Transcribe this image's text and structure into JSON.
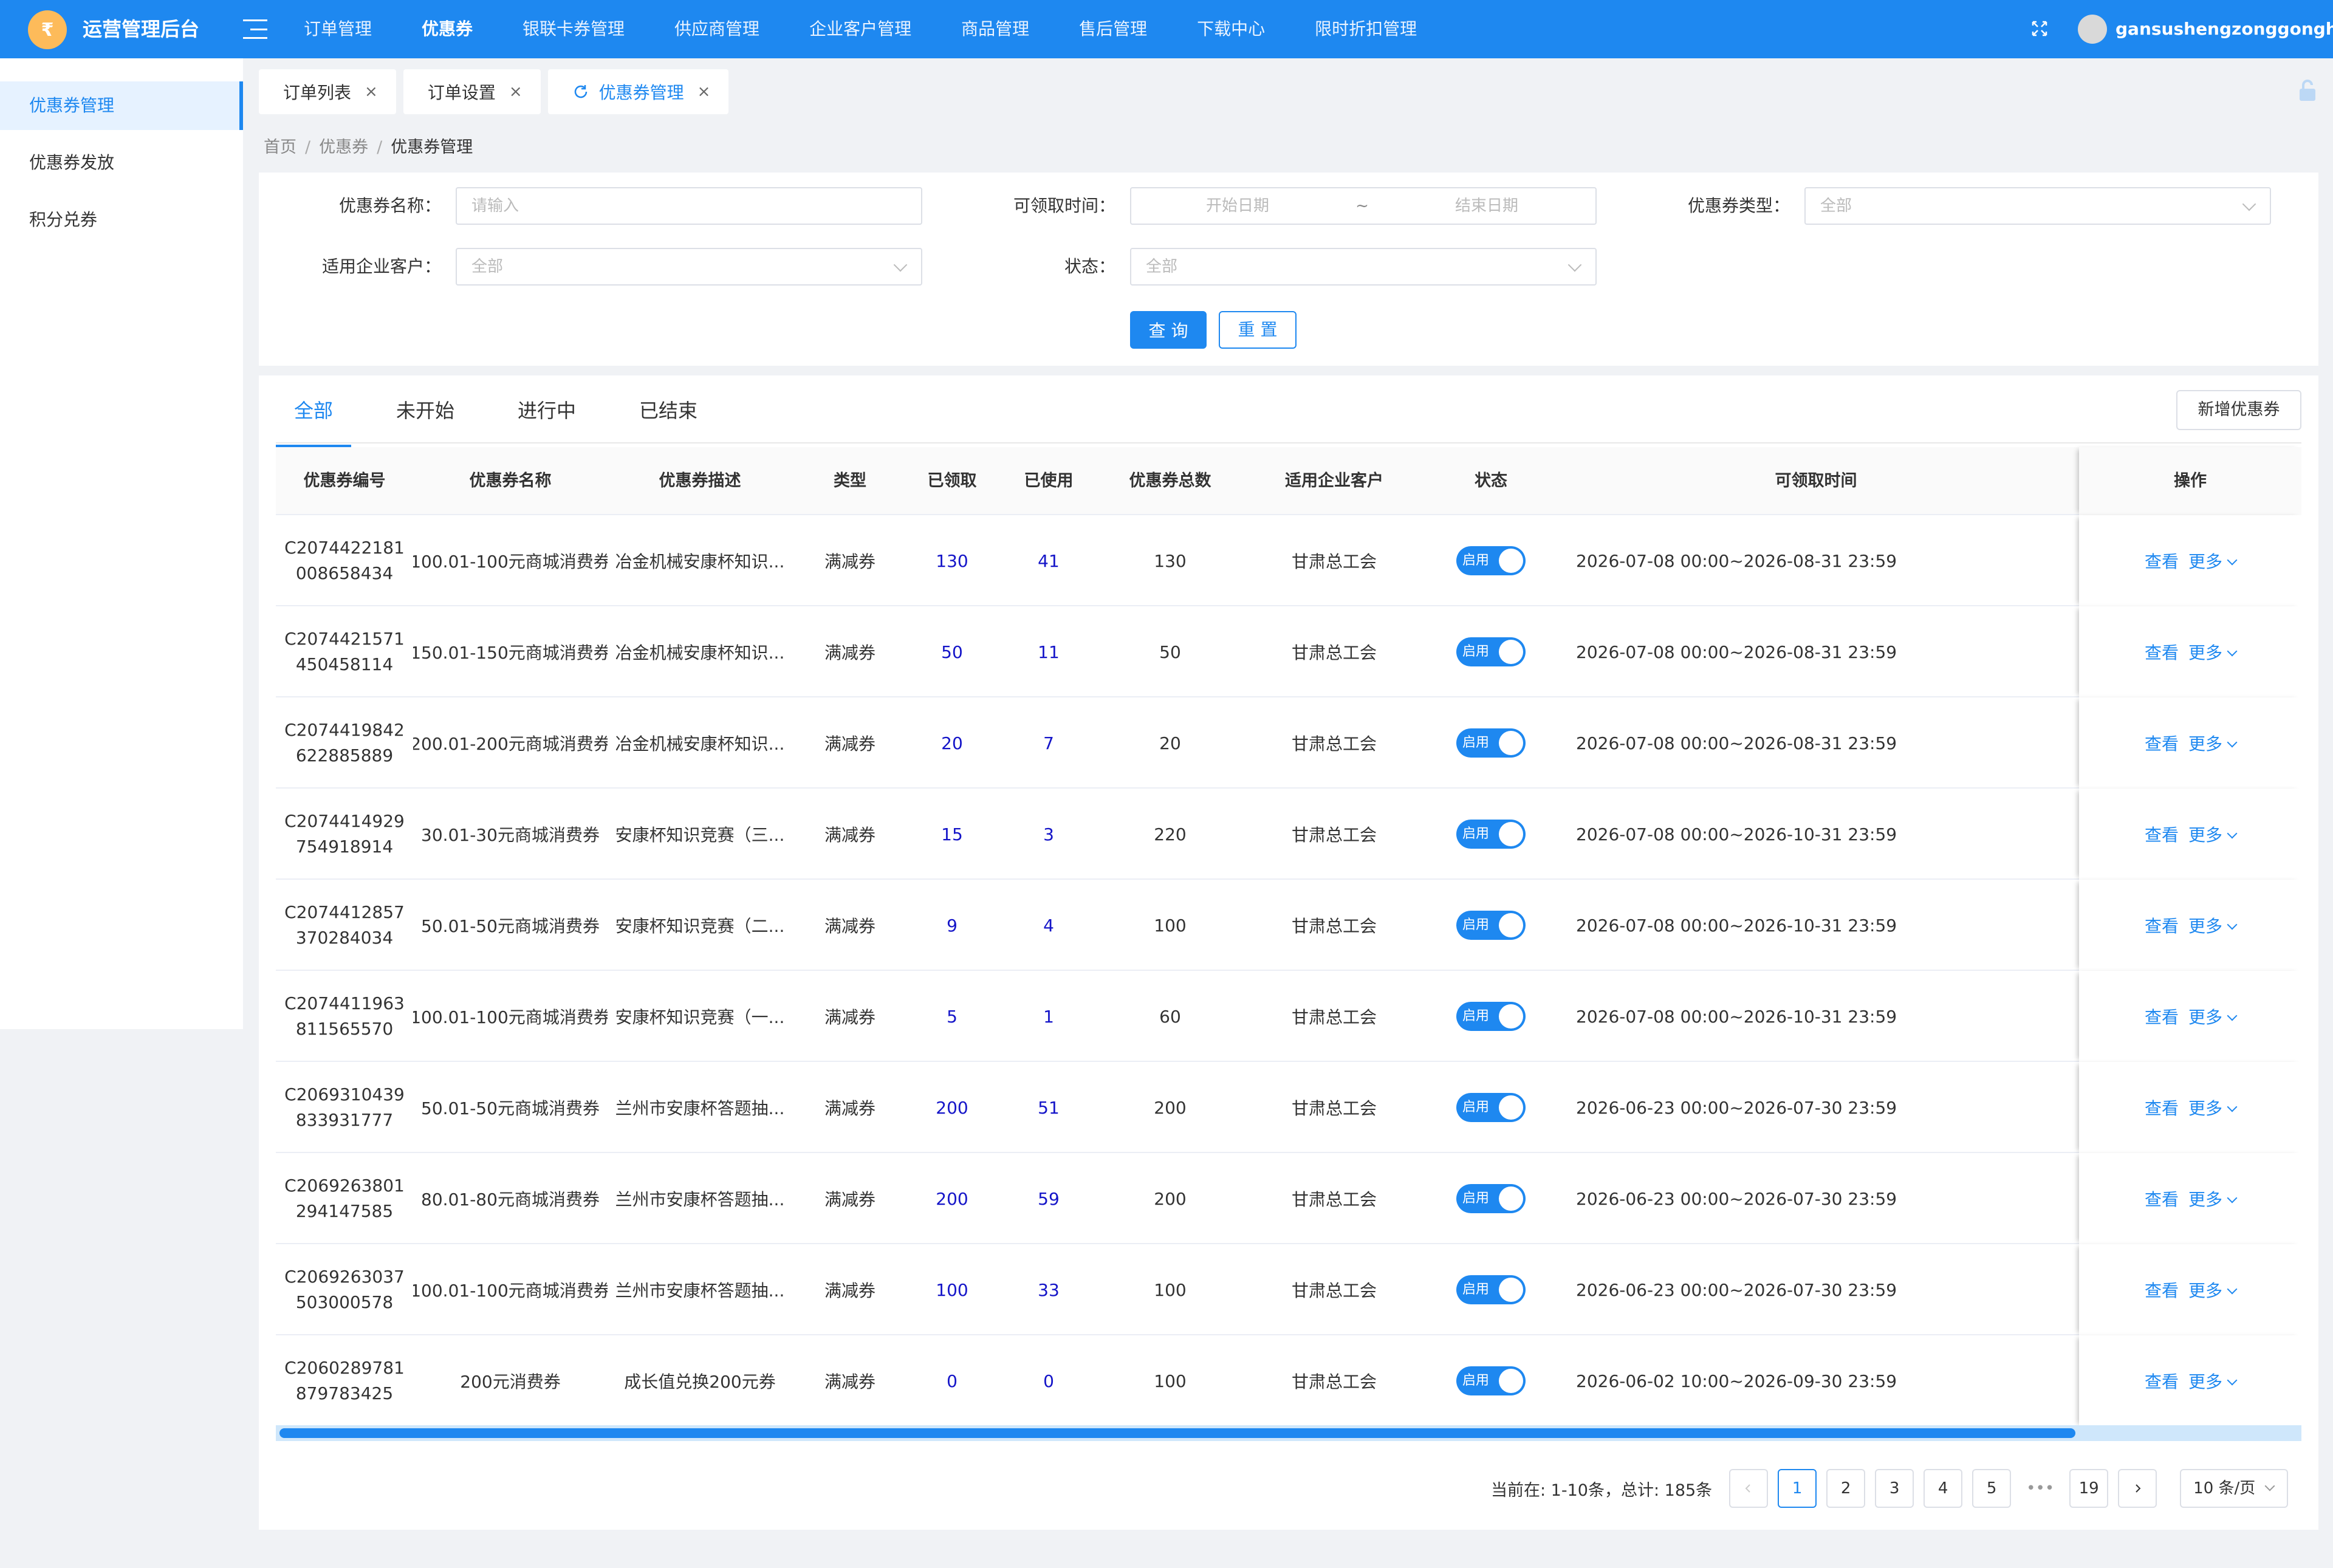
{
  "app": {
    "title": "运营管理后台",
    "logo_char": "₹",
    "username": "gansushengzonggonghui"
  },
  "topnav": [
    {
      "label": "订单管理"
    },
    {
      "label": "优惠券",
      "active": true
    },
    {
      "label": "银联卡券管理"
    },
    {
      "label": "供应商管理"
    },
    {
      "label": "企业客户管理"
    },
    {
      "label": "商品管理"
    },
    {
      "label": "售后管理"
    },
    {
      "label": "下载中心"
    },
    {
      "label": "限时折扣管理"
    }
  ],
  "sidebar": [
    {
      "label": "优惠券管理",
      "active": true
    },
    {
      "label": "优惠券发放"
    },
    {
      "label": "积分兑券"
    }
  ],
  "page_tabs": [
    {
      "label": "订单列表"
    },
    {
      "label": "订单设置"
    },
    {
      "label": "优惠券管理",
      "active": true
    }
  ],
  "breadcrumb": {
    "home": "首页",
    "level1": "优惠券",
    "current": "优惠券管理",
    "sep": "/"
  },
  "filters": {
    "name_label": "优惠券名称：",
    "name_placeholder": "请输入",
    "time_label": "可领取时间：",
    "time_start": "开始日期",
    "time_sep": "~",
    "time_end": "结束日期",
    "type_label": "优惠券类型：",
    "type_value": "全部",
    "customer_label": "适用企业客户：",
    "customer_value": "全部",
    "status_label": "状态：",
    "status_value": "全部",
    "search_button": "查 询",
    "reset_button": "重 置"
  },
  "status_tabs": [
    {
      "label": "全部",
      "active": true
    },
    {
      "label": "未开始"
    },
    {
      "label": "进行中"
    },
    {
      "label": "已结束"
    }
  ],
  "add_button": "新增优惠券",
  "columns": [
    "优惠券编号",
    "优惠券名称",
    "优惠券描述",
    "类型",
    "已领取",
    "已使用",
    "优惠券总数",
    "适用企业客户",
    "状态",
    "可领取时间",
    "操作"
  ],
  "rows": [
    {
      "code": "C2074422181008658434",
      "name": "100.01-100元商城消费券",
      "desc": "冶金机械安康杯知识...",
      "type": "满减券",
      "claimed": "130",
      "used": "41",
      "total": "130",
      "customer": "甘肃总工会",
      "status": "启用",
      "time": "2026-07-08 00:00~2026-08-31 23:59"
    },
    {
      "code": "C2074421571450458114",
      "name": "150.01-150元商城消费券",
      "desc": "冶金机械安康杯知识...",
      "type": "满减券",
      "claimed": "50",
      "used": "11",
      "total": "50",
      "customer": "甘肃总工会",
      "status": "启用",
      "time": "2026-07-08 00:00~2026-08-31 23:59"
    },
    {
      "code": "C2074419842622885889",
      "name": "200.01-200元商城消费券",
      "desc": "冶金机械安康杯知识...",
      "type": "满减券",
      "claimed": "20",
      "used": "7",
      "total": "20",
      "customer": "甘肃总工会",
      "status": "启用",
      "time": "2026-07-08 00:00~2026-08-31 23:59"
    },
    {
      "code": "C2074414929754918914",
      "name": "30.01-30元商城消费券",
      "desc": "安康杯知识竞赛（三...",
      "type": "满减券",
      "claimed": "15",
      "used": "3",
      "total": "220",
      "customer": "甘肃总工会",
      "status": "启用",
      "time": "2026-07-08 00:00~2026-10-31 23:59"
    },
    {
      "code": "C2074412857370284034",
      "name": "50.01-50元商城消费券",
      "desc": "安康杯知识竞赛（二...",
      "type": "满减券",
      "claimed": "9",
      "used": "4",
      "total": "100",
      "customer": "甘肃总工会",
      "status": "启用",
      "time": "2026-07-08 00:00~2026-10-31 23:59"
    },
    {
      "code": "C2074411963811565570",
      "name": "100.01-100元商城消费券",
      "desc": "安康杯知识竞赛（一...",
      "type": "满减券",
      "claimed": "5",
      "used": "1",
      "total": "60",
      "customer": "甘肃总工会",
      "status": "启用",
      "time": "2026-07-08 00:00~2026-10-31 23:59"
    },
    {
      "code": "C2069310439833931777",
      "name": "50.01-50元商城消费券",
      "desc": "兰州市安康杯答题抽...",
      "type": "满减券",
      "claimed": "200",
      "used": "51",
      "total": "200",
      "customer": "甘肃总工会",
      "status": "启用",
      "time": "2026-06-23 00:00~2026-07-30 23:59"
    },
    {
      "code": "C2069263801294147585",
      "name": "80.01-80元商城消费券",
      "desc": "兰州市安康杯答题抽...",
      "type": "满减券",
      "claimed": "200",
      "used": "59",
      "total": "200",
      "customer": "甘肃总工会",
      "status": "启用",
      "time": "2026-06-23 00:00~2026-07-30 23:59"
    },
    {
      "code": "C2069263037503000578",
      "name": "100.01-100元商城消费券",
      "desc": "兰州市安康杯答题抽...",
      "type": "满减券",
      "claimed": "100",
      "used": "33",
      "total": "100",
      "customer": "甘肃总工会",
      "status": "启用",
      "time": "2026-06-23 00:00~2026-07-30 23:59"
    },
    {
      "code": "C2060289781879783425",
      "name": "200元消费券",
      "desc": "成长值兑换200元券",
      "type": "满减券",
      "claimed": "0",
      "used": "0",
      "total": "100",
      "customer": "甘肃总工会",
      "status": "启用",
      "time": "2026-06-02 10:00~2026-09-30 23:59"
    }
  ],
  "row_actions": {
    "view": "查看",
    "more": "更多"
  },
  "pagination": {
    "info": "当前在: 1-10条，总计: 185条",
    "pages": [
      "1",
      "2",
      "3",
      "4",
      "5"
    ],
    "ellipsis": "•••",
    "last": "19",
    "current": "1",
    "page_size": "10 条/页"
  }
}
